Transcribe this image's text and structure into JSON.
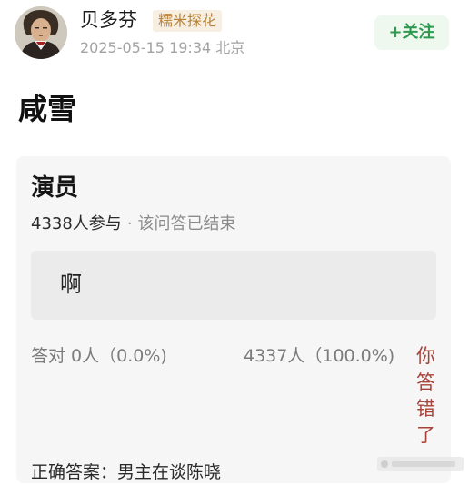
{
  "author": {
    "name": "贝多芬",
    "badge": "糯米探花",
    "meta": "2025-05-15 19:34 北京",
    "avatar_icon": "beethoven-portrait-avatar"
  },
  "follow_button": {
    "label": "+关注",
    "color": "#2f9a4f"
  },
  "post": {
    "title": "咸雪"
  },
  "quiz": {
    "title": "演员",
    "participants": "4338人参与",
    "separator": "·",
    "status": "该问答已结束",
    "option": "啊",
    "result_correct": "答对  0人（0.0%)",
    "result_total": "4337人（100.0%)",
    "wrong_label": "你答错了",
    "answer_line": "正确答案：男主在谈陈晓"
  },
  "colors": {
    "accent_green": "#2f9a4f",
    "badge_gold": "#b9833a",
    "wrong_red": "#a8433a"
  }
}
